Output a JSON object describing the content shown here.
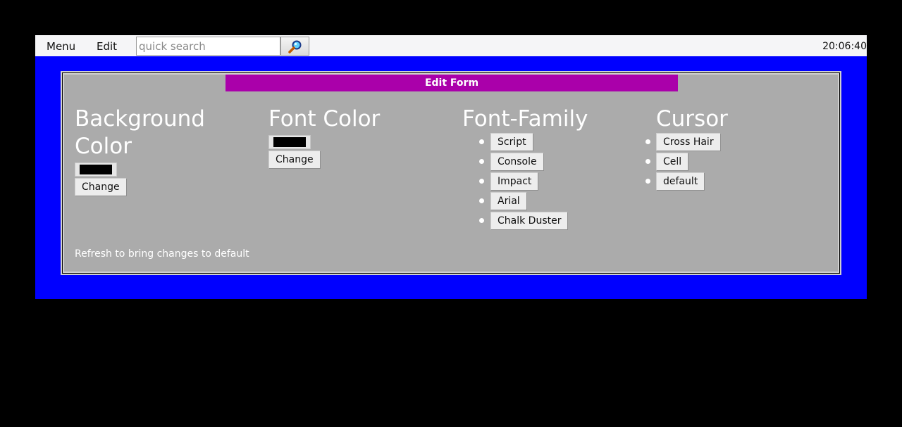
{
  "topbar": {
    "menu_label": "Menu",
    "edit_label": "Edit",
    "search_placeholder": "quick search",
    "search_value": "",
    "search_button_icon": "magnifier-icon",
    "clock": "20:06:40"
  },
  "form": {
    "title": "Edit Form",
    "background_color": {
      "heading": "Background Color",
      "swatch_color": "#000000",
      "button_label": "Change"
    },
    "font_color": {
      "heading": "Font Color",
      "swatch_color": "#000000",
      "button_label": "Change"
    },
    "font_family": {
      "heading": "Font-Family",
      "options": [
        "Script",
        "Console",
        "Impact",
        "Arial",
        "Chalk Duster"
      ]
    },
    "cursor": {
      "heading": "Cursor",
      "options": [
        "Cross Hair",
        "Cell",
        "default"
      ]
    },
    "footer_note": "Refresh to bring changes to default"
  },
  "colors": {
    "page_background": "#000000",
    "app_background": "#0000ff",
    "topbar_background": "#f5f5f7",
    "form_background": "#ababab",
    "title_bar": "#aa00aa",
    "text_light": "#ffffff"
  }
}
